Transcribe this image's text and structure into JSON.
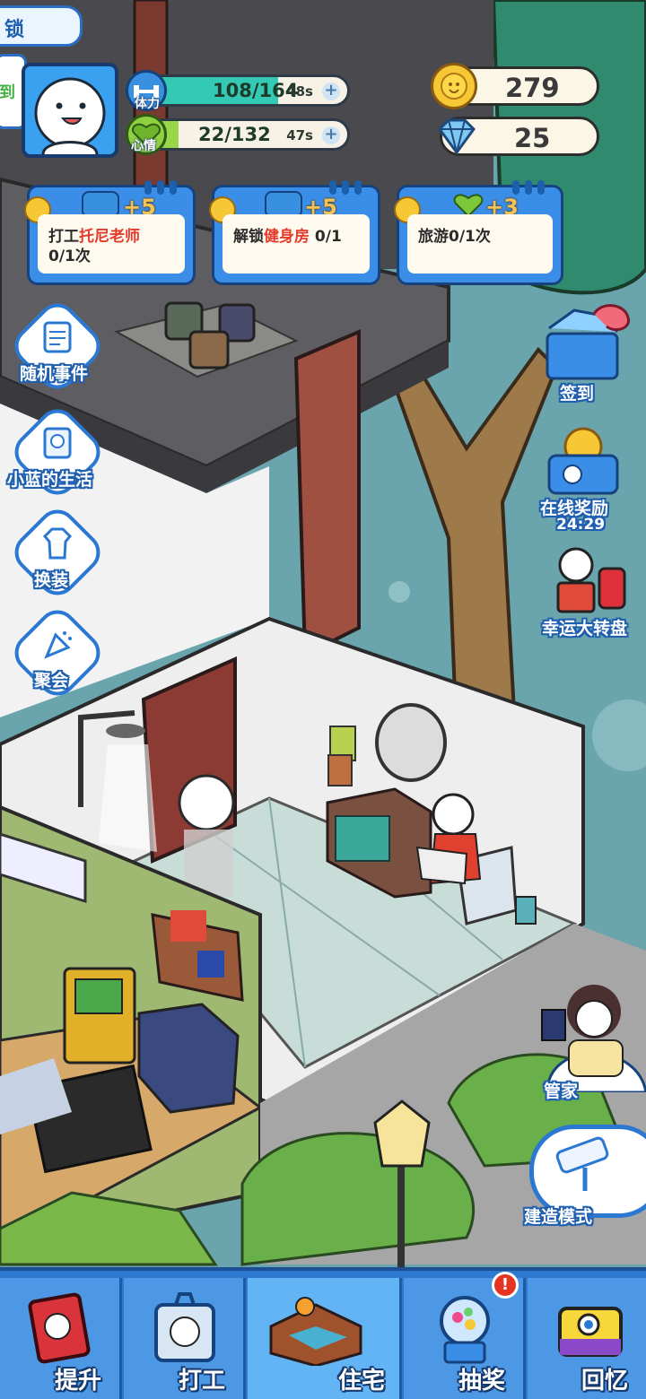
{
  "top_left": {
    "lock_label": "锁",
    "sign_label": "到"
  },
  "stats": {
    "stamina": {
      "icon_label": "体力",
      "value": "108/164",
      "timer": "48s",
      "fill_fraction": 0.66,
      "color": "#33c9b4"
    },
    "mood": {
      "icon_label": "心情",
      "value": "22/132",
      "timer": "47s",
      "fill_fraction": 0.17,
      "color": "#9ad64a"
    }
  },
  "currency": {
    "coins": "279",
    "gems": "25"
  },
  "tasks": [
    {
      "reward": "+5",
      "line1_prefix": "打工",
      "line1_highlight": "托尼老师",
      "line2": "0/1次",
      "icon": "dumbbell-icon"
    },
    {
      "reward": "+5",
      "line1_prefix": "解锁",
      "line1_highlight": "健身房",
      "line1_suffix": " 0/1",
      "icon": "dumbbell-icon"
    },
    {
      "reward": "+3",
      "line1_prefix": "旅游0/1次",
      "icon": "heart-icon"
    }
  ],
  "left_buttons": [
    {
      "label": "随机事件",
      "icon": "notepad-icon"
    },
    {
      "label": "小蓝的生活",
      "icon": "diary-icon"
    },
    {
      "label": "换装",
      "icon": "shirt-icon"
    },
    {
      "label": "聚会",
      "icon": "party-popper-icon"
    }
  ],
  "right_buttons": {
    "sign_in": "签到",
    "online_reward": "在线奖励",
    "online_timer": "24:29",
    "lucky_wheel": "幸运大转盘",
    "butler": "管家",
    "build_mode": "建造模式"
  },
  "nav": [
    {
      "label": "提升",
      "icon": "book-icon"
    },
    {
      "label": "打工",
      "icon": "work-badge-icon"
    },
    {
      "label": "住宅",
      "icon": "house-room-icon",
      "active": true
    },
    {
      "label": "抽奖",
      "icon": "gacha-machine-icon",
      "badge": "!"
    },
    {
      "label": "回忆",
      "icon": "camera-icon"
    }
  ],
  "colors": {
    "primary_blue": "#2f78cf",
    "outline_navy": "#16427e",
    "highlight_red": "#e43b2b",
    "coin_gold": "#f6c835"
  }
}
